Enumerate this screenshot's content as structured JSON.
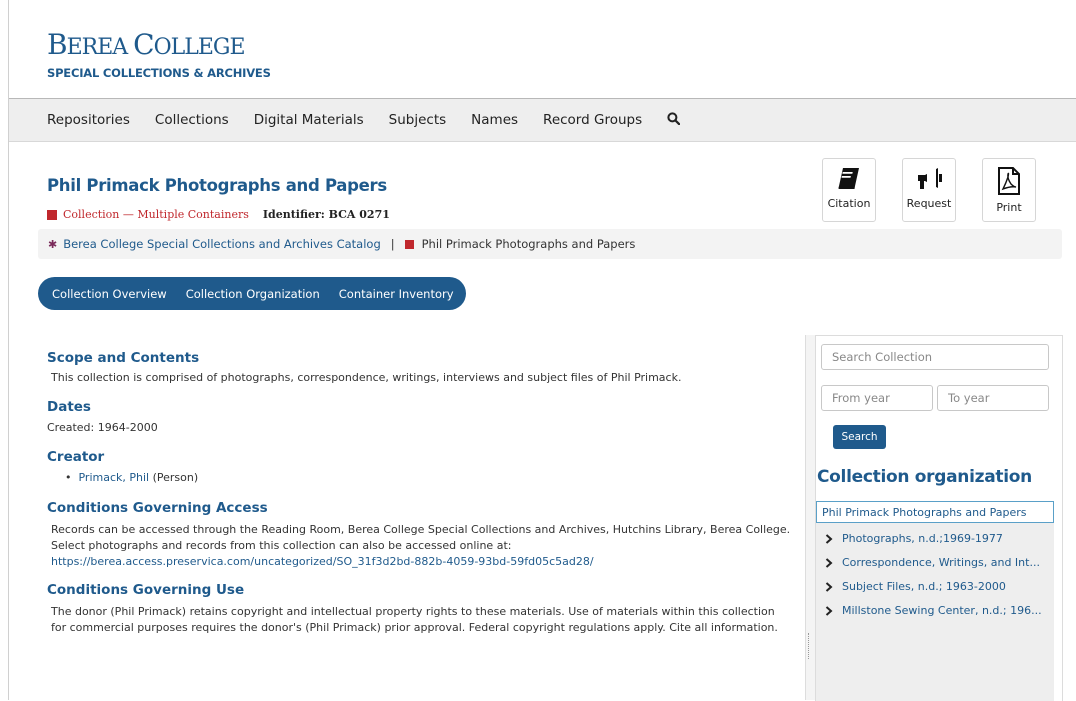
{
  "brand": {
    "name_first": "B",
    "name_first_rest": "EREA ",
    "name_second": "C",
    "name_second_rest": "OLLEGE",
    "subtitle": "SPECIAL COLLECTIONS & ARCHIVES"
  },
  "nav": {
    "items": [
      "Repositories",
      "Collections",
      "Digital Materials",
      "Subjects",
      "Names",
      "Record Groups"
    ]
  },
  "record": {
    "title": "Phil Primack Photographs and Papers",
    "type_label": "Collection — Multiple Containers",
    "identifier": "Identifier: BCA 0271"
  },
  "actions": {
    "citation": "Citation",
    "request": "Request",
    "print": "Print"
  },
  "breadcrumb": {
    "home": "Berea College Special Collections and Archives Catalog",
    "separator": "|",
    "current": "Phil Primack Photographs and Papers"
  },
  "tabs": [
    "Collection Overview",
    "Collection Organization",
    "Container Inventory"
  ],
  "sections": {
    "scope": {
      "heading": "Scope and Contents",
      "text": "This collection is comprised of photographs, correspondence, writings, interviews and subject files of Phil Primack."
    },
    "dates": {
      "heading": "Dates",
      "text": "Created: 1964-2000"
    },
    "creator": {
      "heading": "Creator",
      "name": "Primack, Phil",
      "role": "(Person)"
    },
    "access": {
      "heading": "Conditions Governing Access",
      "text": "Records can be accessed through the Reading Room, Berea College Special Collections and Archives, Hutchins Library, Berea College. Select photographs and records from this collection can also be accessed online at:",
      "url": "https://berea.access.preservica.com/uncategorized/SO_31f3d2bd-882b-4059-93bd-59fd05c5ad28/"
    },
    "use": {
      "heading": "Conditions Governing Use",
      "text": "The donor (Phil Primack) retains copyright and intellectual property rights to these materials. Use of materials within this collection for commercial purposes requires the donor's (Phil Primack) prior approval. Federal copyright regulations apply. Cite all information."
    }
  },
  "sidebar": {
    "search_placeholder": "Search Collection",
    "from_placeholder": "From year",
    "to_placeholder": "To year",
    "search_button": "Search",
    "org_heading": "Collection organization",
    "tree_root": "Phil Primack Photographs and Papers",
    "tree_items": [
      "Photographs, n.d.;1969-1977",
      "Correspondence, Writings, and Int...",
      "Subject Files, n.d.; 1963-2000",
      "Millstone Sewing Center, n.d.; 196..."
    ]
  }
}
